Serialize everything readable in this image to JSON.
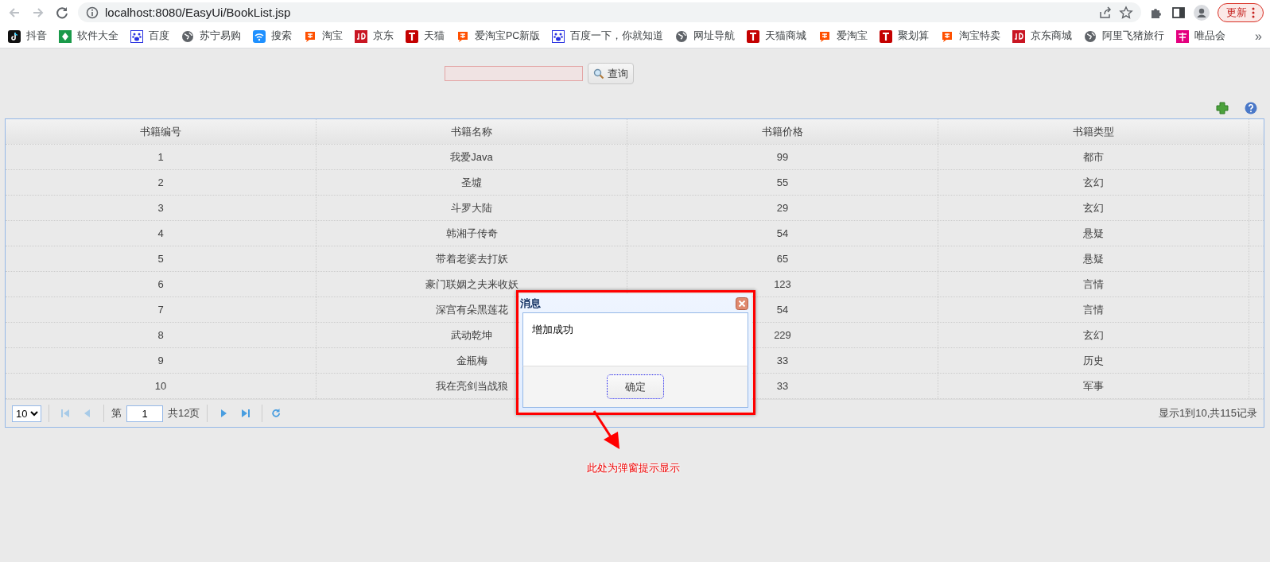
{
  "browser": {
    "address": "localhost:8080/EasyUi/BookList.jsp",
    "update_button": "更新",
    "overflow": "»",
    "bookmarks": [
      {
        "label": "抖音",
        "kind": "tiktok"
      },
      {
        "label": "软件大全",
        "kind": "green"
      },
      {
        "label": "百度",
        "kind": "paw"
      },
      {
        "label": "苏宁易购",
        "kind": "globe"
      },
      {
        "label": "搜索",
        "kind": "wifi"
      },
      {
        "label": "淘宝",
        "kind": "taobao"
      },
      {
        "label": "京东",
        "kind": "jd"
      },
      {
        "label": "天猫",
        "kind": "tmall"
      },
      {
        "label": "爱淘宝PC新版",
        "kind": "taobao"
      },
      {
        "label": "百度一下，你就知道",
        "kind": "paw"
      },
      {
        "label": "网址导航",
        "kind": "globe"
      },
      {
        "label": "天猫商城",
        "kind": "tmall"
      },
      {
        "label": "爱淘宝",
        "kind": "taobao"
      },
      {
        "label": "聚划算",
        "kind": "tmall"
      },
      {
        "label": "淘宝特卖",
        "kind": "taobao"
      },
      {
        "label": "京东商城",
        "kind": "jd"
      },
      {
        "label": "阿里飞猪旅行",
        "kind": "globe"
      },
      {
        "label": "唯品会",
        "kind": "vip"
      }
    ]
  },
  "search": {
    "button": "查询"
  },
  "table": {
    "columns": [
      "书籍编号",
      "书籍名称",
      "书籍价格",
      "书籍类型"
    ],
    "rows": [
      [
        "1",
        "我爱Java",
        "99",
        "都市"
      ],
      [
        "2",
        "圣墟",
        "55",
        "玄幻"
      ],
      [
        "3",
        "斗罗大陆",
        "29",
        "玄幻"
      ],
      [
        "4",
        "韩湘子传奇",
        "54",
        "悬疑"
      ],
      [
        "5",
        "带着老婆去打妖",
        "65",
        "悬疑"
      ],
      [
        "6",
        "豪门联姻之夫来收妖",
        "123",
        "言情"
      ],
      [
        "7",
        "深宫有朵黑莲花",
        "54",
        "言情"
      ],
      [
        "8",
        "武动乾坤",
        "229",
        "玄幻"
      ],
      [
        "9",
        "金瓶梅",
        "33",
        "历史"
      ],
      [
        "10",
        "我在亮剑当战狼",
        "33",
        "军事"
      ]
    ]
  },
  "pager": {
    "page_size": "10",
    "page_label": "第",
    "page": "1",
    "total_pages": "共12页",
    "summary": "显示1到10,共115记录",
    "buttons": [
      {
        "kind": "first",
        "disabled": true
      },
      {
        "kind": "prev",
        "disabled": true
      },
      {
        "kind": "next",
        "disabled": false
      },
      {
        "kind": "last",
        "disabled": false
      }
    ]
  },
  "dialog": {
    "title": "消息",
    "message": "增加成功",
    "ok_button": "确定"
  },
  "annotation": {
    "text": "此处为弹窗提示显示"
  }
}
